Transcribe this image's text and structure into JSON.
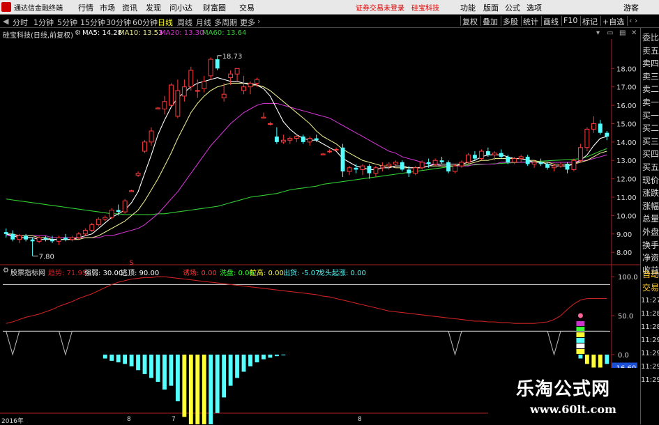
{
  "app": {
    "title": "通达信金融终端",
    "menu": [
      "行情",
      "市场",
      "资讯",
      "发现",
      "问小达",
      "财富圈",
      "交易"
    ],
    "notice": "证券交易未登录",
    "stock_name_center": "硅宝科技",
    "right_menu": [
      "功能",
      "版面",
      "公式",
      "选项"
    ],
    "guest": "游客"
  },
  "toolbar": {
    "periods": [
      "分时",
      "1分钟",
      "5分钟",
      "15分钟",
      "30分钟",
      "60分钟",
      "日线",
      "周线",
      "月线",
      "多周期",
      "更多"
    ],
    "active_period": "日线",
    "right_buttons": [
      "复权",
      "叠加",
      "多股",
      "统计",
      "画线",
      "F10",
      "标记",
      "+自选"
    ]
  },
  "chart_header": {
    "stock": "硅宝科技(日线,前复权)",
    "ma5": "MA5: 14.28",
    "ma10": "MA10: 13.53",
    "ma20": "MA20: 13.30",
    "ma60": "MA60: 13.64"
  },
  "colors": {
    "up": "#ff3b3b",
    "down": "#54ffff",
    "ma5": "#ffffff",
    "ma10": "#e6e68c",
    "ma20": "#cc33cc",
    "ma60": "#33cc33",
    "trend": "#cc2222",
    "yellow_bar": "#ffff33",
    "cyan_bar": "#54ffff"
  },
  "annotations": {
    "high": "18.73",
    "low": "7.80",
    "marker_s": "S"
  },
  "right_panel": [
    "委比",
    "卖五",
    "卖四",
    "卖三",
    "卖二",
    "卖一",
    "买一",
    "买二",
    "买三",
    "买四",
    "买五",
    "现价",
    "涨跌",
    "涨幅",
    "总量",
    "外盘",
    "换手",
    "净资",
    "收益"
  ],
  "right_panel_lower": [
    "自动",
    "交易",
    "11:27",
    "11:28",
    "11:28",
    "11:29",
    "11:29",
    "11:29",
    "11:29"
  ],
  "indicator": {
    "name": "股票指标网",
    "trend_label": "趋势: 71.95",
    "strong_weak": "强弱: 30.00",
    "escape": "逃顶: 90.00",
    "top_play": "诱场: 0.00",
    "wash": "洗盘: 0.00",
    "raise": "拉高: 0.00",
    "ship": "出货: -5.07",
    "dragon": "龙头起涨: 0.00",
    "value_badge": "-16.60"
  },
  "x_labels": [
    "2016年",
    "8",
    "7",
    "8"
  ],
  "watermark": {
    "cn": "乐淘公式网",
    "url": "www.60lt.com"
  },
  "chart_data": {
    "type": "candlestick",
    "title": "硅宝科技(日线,前复权)",
    "y_ticks": [
      8.0,
      9.0,
      10.0,
      11.0,
      12.0,
      13.0,
      14.0,
      15.0,
      16.0,
      17.0,
      18.0
    ],
    "ylim": [
      7.4,
      19.3
    ],
    "candles": [
      [
        9.1,
        9.3,
        8.8,
        9.0
      ],
      [
        9.0,
        9.2,
        8.6,
        8.7
      ],
      [
        8.7,
        9.0,
        8.5,
        8.9
      ],
      [
        8.9,
        9.0,
        8.6,
        8.7
      ],
      [
        8.7,
        8.8,
        7.8,
        8.6
      ],
      [
        8.6,
        8.9,
        8.5,
        8.8
      ],
      [
        8.8,
        8.9,
        8.6,
        8.7
      ],
      [
        8.7,
        8.9,
        8.5,
        8.6
      ],
      [
        8.6,
        8.9,
        8.4,
        8.8
      ],
      [
        8.8,
        9.0,
        8.6,
        8.7
      ],
      [
        8.7,
        8.9,
        8.6,
        8.8
      ],
      [
        8.8,
        9.1,
        8.7,
        9.0
      ],
      [
        9.0,
        9.3,
        8.9,
        9.2
      ],
      [
        9.2,
        9.6,
        9.1,
        9.5
      ],
      [
        9.5,
        9.9,
        9.4,
        9.8
      ],
      [
        9.8,
        10.0,
        9.7,
        9.9
      ],
      [
        9.9,
        10.4,
        9.8,
        10.3
      ],
      [
        10.3,
        10.6,
        10.0,
        10.2
      ],
      [
        10.2,
        10.9,
        10.1,
        10.8
      ],
      [
        11.3,
        11.4,
        11.3,
        11.35
      ],
      [
        12.2,
        12.4,
        12.1,
        12.3
      ],
      [
        13.5,
        14.1,
        13.4,
        14.0
      ],
      [
        14.0,
        14.8,
        13.8,
        14.6
      ],
      [
        15.8,
        15.9,
        15.8,
        15.85
      ],
      [
        15.8,
        16.5,
        15.5,
        16.2
      ],
      [
        16.0,
        17.2,
        15.9,
        17.1
      ],
      [
        15.4,
        17.4,
        15.3,
        16.8
      ],
      [
        16.5,
        17.4,
        16.2,
        17.0
      ],
      [
        17.0,
        18.1,
        16.8,
        17.9
      ],
      [
        16.8,
        17.4,
        16.4,
        16.8
      ],
      [
        16.9,
        17.6,
        16.7,
        17.3
      ],
      [
        17.6,
        18.6,
        17.4,
        18.5
      ],
      [
        18.5,
        18.7,
        17.9,
        18.0
      ],
      [
        16.4,
        17.2,
        16.2,
        16.6
      ],
      [
        17.5,
        17.9,
        17.1,
        17.7
      ],
      [
        17.7,
        18.0,
        17.3,
        18.0
      ],
      [
        16.8,
        17.6,
        16.6,
        17.0
      ],
      [
        17.0,
        17.3,
        16.6,
        17.2
      ],
      [
        17.2,
        17.5,
        17.0,
        17.4
      ],
      [
        15.3,
        15.6,
        15.3,
        15.35
      ],
      [
        15.0,
        15.1,
        14.9,
        15.0
      ],
      [
        14.3,
        14.8,
        13.9,
        14.0
      ],
      [
        14.0,
        14.4,
        13.9,
        14.1
      ],
      [
        14.1,
        14.3,
        13.9,
        14.2
      ],
      [
        14.2,
        14.4,
        14.0,
        14.3
      ],
      [
        14.3,
        14.4,
        13.9,
        14.0
      ],
      [
        14.0,
        14.3,
        13.8,
        14.2
      ],
      [
        14.2,
        14.4,
        14.0,
        14.1
      ],
      [
        13.3,
        13.4,
        13.3,
        13.35
      ],
      [
        13.5,
        13.6,
        13.4,
        13.5
      ],
      [
        13.6,
        13.7,
        13.5,
        13.6
      ],
      [
        13.7,
        13.9,
        12.1,
        12.4
      ],
      [
        12.4,
        12.7,
        12.2,
        12.6
      ],
      [
        12.6,
        12.8,
        12.3,
        12.5
      ],
      [
        12.5,
        12.8,
        12.2,
        12.7
      ],
      [
        12.7,
        12.8,
        12.0,
        12.3
      ],
      [
        12.3,
        12.7,
        12.1,
        12.6
      ],
      [
        12.6,
        12.9,
        12.4,
        12.7
      ],
      [
        12.7,
        12.9,
        12.5,
        12.8
      ],
      [
        12.8,
        13.0,
        12.6,
        12.9
      ],
      [
        12.9,
        13.0,
        12.4,
        12.5
      ],
      [
        12.5,
        12.7,
        12.1,
        12.3
      ],
      [
        12.3,
        12.7,
        12.2,
        12.6
      ],
      [
        12.6,
        13.0,
        12.5,
        12.9
      ],
      [
        12.9,
        13.1,
        12.6,
        12.8
      ],
      [
        12.8,
        13.1,
        12.7,
        13.0
      ],
      [
        13.0,
        13.2,
        12.8,
        12.9
      ],
      [
        12.9,
        13.0,
        12.3,
        12.4
      ],
      [
        12.4,
        12.8,
        12.3,
        12.7
      ],
      [
        12.7,
        13.0,
        12.6,
        12.9
      ],
      [
        12.9,
        13.4,
        12.8,
        13.3
      ],
      [
        13.3,
        13.5,
        13.0,
        13.1
      ],
      [
        13.1,
        13.6,
        13.0,
        13.5
      ],
      [
        13.5,
        13.7,
        13.2,
        13.3
      ],
      [
        13.3,
        13.5,
        13.0,
        13.4
      ],
      [
        13.4,
        13.6,
        13.1,
        13.2
      ],
      [
        13.2,
        13.3,
        12.8,
        12.9
      ],
      [
        12.9,
        13.2,
        12.8,
        13.1
      ],
      [
        13.1,
        13.3,
        12.9,
        13.2
      ],
      [
        13.2,
        13.3,
        12.7,
        12.8
      ],
      [
        12.8,
        13.0,
        12.6,
        12.9
      ],
      [
        12.9,
        13.1,
        12.7,
        12.8
      ],
      [
        12.8,
        12.9,
        12.5,
        12.6
      ],
      [
        12.6,
        12.8,
        12.4,
        12.7
      ],
      [
        12.7,
        12.9,
        12.6,
        12.8
      ],
      [
        12.8,
        12.9,
        12.3,
        12.5
      ],
      [
        12.5,
        13.1,
        12.4,
        13.0
      ],
      [
        13.0,
        13.9,
        12.9,
        13.7
      ],
      [
        13.7,
        14.8,
        13.5,
        14.7
      ],
      [
        14.7,
        15.4,
        14.5,
        15.0
      ],
      [
        15.0,
        15.2,
        14.4,
        14.5
      ],
      [
        14.5,
        14.6,
        14.1,
        14.3
      ]
    ],
    "ma5": [
      9.0,
      8.9,
      8.8,
      8.8,
      8.8,
      8.7,
      8.7,
      8.7,
      8.7,
      8.7,
      8.7,
      8.8,
      8.9,
      9.0,
      9.3,
      9.6,
      9.9,
      10.1,
      10.3,
      10.7,
      11.3,
      12.3,
      13.3,
      14.4,
      15.2,
      15.9,
      16.4,
      16.7,
      17.0,
      17.2,
      17.3,
      17.4,
      17.5,
      17.4,
      17.3,
      17.3,
      17.2,
      17.2,
      17.1,
      16.9,
      16.5,
      15.8,
      15.1,
      14.7,
      14.4,
      14.2,
      14.1,
      14.1,
      13.9,
      13.7,
      13.5,
      13.1,
      12.9,
      12.7,
      12.6,
      12.5,
      12.5,
      12.6,
      12.6,
      12.7,
      12.7,
      12.6,
      12.6,
      12.6,
      12.7,
      12.8,
      12.8,
      12.8,
      12.8,
      12.8,
      12.9,
      13.0,
      13.2,
      13.3,
      13.3,
      13.3,
      13.2,
      13.1,
      13.1,
      13.0,
      12.9,
      12.9,
      12.8,
      12.7,
      12.7,
      12.7,
      12.8,
      13.0,
      13.3,
      13.8,
      14.2,
      14.3
    ],
    "ma10": [
      9.0,
      9.0,
      8.9,
      8.9,
      8.9,
      8.8,
      8.8,
      8.7,
      8.7,
      8.7,
      8.7,
      8.7,
      8.8,
      8.8,
      8.9,
      9.1,
      9.3,
      9.5,
      9.7,
      10.0,
      10.3,
      10.8,
      11.4,
      12.0,
      12.7,
      13.4,
      14.2,
      14.9,
      15.6,
      16.1,
      16.5,
      16.8,
      17.0,
      17.1,
      17.2,
      17.2,
      17.2,
      17.1,
      17.1,
      17.0,
      16.8,
      16.5,
      16.2,
      15.9,
      15.6,
      15.3,
      15.0,
      14.6,
      14.3,
      14.1,
      13.9,
      13.6,
      13.4,
      13.2,
      13.0,
      12.9,
      12.8,
      12.7,
      12.7,
      12.6,
      12.6,
      12.6,
      12.6,
      12.6,
      12.7,
      12.7,
      12.7,
      12.7,
      12.7,
      12.8,
      12.8,
      12.9,
      13.0,
      13.0,
      13.1,
      13.1,
      13.1,
      13.1,
      13.1,
      13.0,
      13.0,
      12.9,
      12.9,
      12.8,
      12.8,
      12.8,
      12.8,
      12.9,
      13.0,
      13.2,
      13.4,
      13.5
    ],
    "ma20": [
      8.9,
      8.9,
      8.9,
      8.9,
      8.9,
      8.9,
      8.9,
      8.8,
      8.8,
      8.8,
      8.8,
      8.8,
      8.8,
      8.8,
      8.8,
      8.9,
      8.9,
      9.0,
      9.1,
      9.2,
      9.3,
      9.5,
      9.8,
      10.1,
      10.5,
      10.9,
      11.3,
      11.8,
      12.3,
      12.8,
      13.3,
      13.8,
      14.2,
      14.6,
      15.0,
      15.3,
      15.6,
      15.8,
      16.0,
      16.1,
      16.1,
      16.1,
      16.0,
      15.9,
      15.8,
      15.7,
      15.6,
      15.5,
      15.4,
      15.3,
      15.1,
      14.9,
      14.7,
      14.5,
      14.3,
      14.1,
      13.9,
      13.7,
      13.5,
      13.4,
      13.2,
      13.1,
      13.0,
      12.9,
      12.8,
      12.8,
      12.7,
      12.7,
      12.7,
      12.7,
      12.7,
      12.8,
      12.8,
      12.8,
      12.8,
      12.9,
      12.9,
      12.9,
      12.9,
      12.9,
      12.9,
      12.9,
      12.9,
      12.9,
      12.9,
      12.9,
      12.9,
      13.0,
      13.0,
      13.1,
      13.2,
      13.3
    ],
    "ma60": [
      10.9,
      10.85,
      10.8,
      10.75,
      10.7,
      10.65,
      10.6,
      10.55,
      10.5,
      10.45,
      10.4,
      10.35,
      10.3,
      10.25,
      10.2,
      10.15,
      10.1,
      10.1,
      10.05,
      10.05,
      10.05,
      10.05,
      10.05,
      10.1,
      10.1,
      10.15,
      10.2,
      10.25,
      10.3,
      10.35,
      10.4,
      10.45,
      10.5,
      10.6,
      10.7,
      10.8,
      10.9,
      11.0,
      11.05,
      11.1,
      11.15,
      11.2,
      11.3,
      11.4,
      11.45,
      11.5,
      11.55,
      11.6,
      11.7,
      11.75,
      11.8,
      11.85,
      11.9,
      11.95,
      12.0,
      12.05,
      12.1,
      12.15,
      12.2,
      12.25,
      12.3,
      12.35,
      12.4,
      12.45,
      12.5,
      12.55,
      12.6,
      12.65,
      12.7,
      12.72,
      12.74,
      12.76,
      12.78,
      12.8,
      12.82,
      12.84,
      12.86,
      12.88,
      12.9,
      12.92,
      12.94,
      12.96,
      12.98,
      13.0,
      13.02,
      13.04,
      13.06,
      13.1,
      13.2,
      13.35,
      13.5,
      13.64
    ],
    "indicator": {
      "ylim": [
        -60,
        110
      ],
      "y_ticks": [
        100.0,
        50.0,
        0.0
      ],
      "line_90": 90,
      "line_30": 30,
      "trend": [
        40,
        42,
        45,
        48,
        50,
        52,
        55,
        58,
        62,
        65,
        68,
        72,
        75,
        78,
        82,
        86,
        90,
        93,
        95,
        97,
        98,
        99,
        99,
        100,
        100,
        99,
        98,
        97,
        96,
        95,
        94,
        93,
        92,
        91,
        90,
        89,
        88,
        87,
        86,
        85,
        84,
        83,
        82,
        81,
        80,
        79,
        78,
        77,
        75,
        74,
        72,
        70,
        68,
        66,
        64,
        62,
        60,
        58,
        56,
        55,
        54,
        53,
        52,
        51,
        50,
        49,
        48,
        47,
        46,
        45,
        44,
        43,
        43,
        42,
        42,
        41,
        41,
        40,
        40,
        40,
        40,
        41,
        42,
        45,
        50,
        58,
        65,
        70,
        72,
        72,
        72,
        72
      ],
      "signal": [
        30,
        0,
        30,
        30,
        30,
        30,
        30,
        30,
        30,
        0,
        30,
        30,
        30,
        30,
        30,
        30,
        30,
        30,
        30,
        30,
        30,
        30,
        30,
        30,
        30,
        30,
        30,
        30,
        30,
        30,
        30,
        30,
        30,
        30,
        30,
        30,
        30,
        30,
        30,
        30,
        30,
        30,
        30,
        30,
        30,
        30,
        30,
        30,
        30,
        30,
        30,
        30,
        30,
        30,
        30,
        30,
        30,
        30,
        30,
        30,
        30,
        30,
        30,
        30,
        30,
        30,
        30,
        30,
        0,
        30,
        30,
        30,
        30,
        30,
        30,
        30,
        30,
        30,
        30,
        30,
        30,
        30,
        30,
        0,
        30,
        30,
        30,
        30,
        30,
        30,
        30,
        30
      ],
      "bars": [
        0,
        0,
        0,
        0,
        0,
        0,
        0,
        0,
        0,
        0,
        0,
        0,
        0,
        0,
        0,
        -5,
        -8,
        -10,
        -12,
        -15,
        -20,
        -25,
        -30,
        -35,
        -45,
        -40,
        -60,
        -80,
        -95,
        -110,
        -115,
        -100,
        -75,
        -55,
        -40,
        -30,
        -22,
        -15,
        -10,
        -6,
        -4,
        -2,
        -1,
        0,
        0,
        0,
        0,
        0,
        0,
        0,
        0,
        0,
        0,
        0,
        0,
        0,
        0,
        0,
        0,
        0,
        0,
        0,
        0,
        0,
        0,
        0,
        0,
        0,
        0,
        0,
        0,
        0,
        0,
        0,
        0,
        0,
        0,
        0,
        0,
        0,
        0,
        0,
        0,
        0,
        0,
        0,
        0,
        -5,
        -12,
        -16.6,
        -16.6,
        -12
      ],
      "bars_cyan": [
        15,
        16,
        17,
        18,
        19,
        20,
        21,
        22,
        23,
        24,
        25,
        26,
        31,
        32,
        33,
        34,
        35,
        36,
        37,
        38,
        39,
        40,
        41,
        42,
        43,
        87,
        91
      ]
    }
  }
}
